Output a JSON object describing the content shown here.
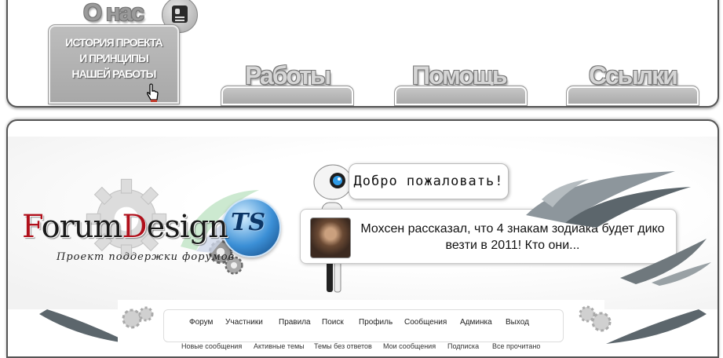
{
  "nav": {
    "about": {
      "title": "О нас",
      "card_line1": "История проекта",
      "card_line2": "и принципы",
      "card_line3": "нашей работы"
    },
    "works": "Работы",
    "help": "Помощь",
    "links": "Ссылки"
  },
  "header": {
    "logo_red1": "F",
    "logo_part1": "orum",
    "logo_red2": "D",
    "logo_part2": "esign",
    "logo_ts": "TS",
    "logo_sub": "Проект поддержки форумов",
    "welcome": "Добро пожаловать!",
    "news": "Мохсен рассказал, что 4 знакам зодиака будет дико везти в 2011! Кто они..."
  },
  "menu": {
    "items": [
      "Форум",
      "Участники",
      "Правила",
      "Поиск",
      "Профиль",
      "Сообщения",
      "Админка",
      "Выход"
    ],
    "sub_items": [
      "Новые сообщения",
      "Активные темы",
      "Темы без ответов",
      "Мои сообщения",
      "Подписка",
      "Все прочитано"
    ]
  },
  "colors": {
    "logo_red": "#b0101b",
    "panel_border": "#555555",
    "card_bg": "#b3b3b3"
  }
}
